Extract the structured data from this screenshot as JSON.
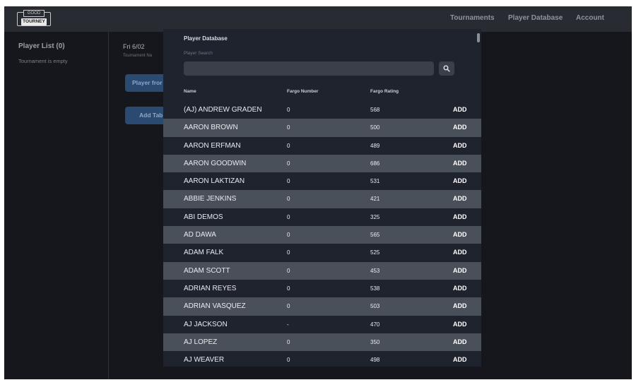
{
  "logo": {
    "top": "GOOD",
    "bottom": "TOURNEY"
  },
  "nav": {
    "tournaments": "Tournaments",
    "player_database": "Player Database",
    "account": "Account"
  },
  "sidebar": {
    "title": "Player List (0)",
    "empty_text": "Tournament is empty"
  },
  "main": {
    "date": "Fri 6/02",
    "tournament_name": "Tournament Na",
    "player_button": "Player fror",
    "add_table_button": "Add Tab"
  },
  "modal": {
    "title": "Player Database",
    "search_label": "Player Search",
    "search_value": "",
    "search_icon": "search-icon",
    "columns": {
      "name": "Name",
      "fargo_number": "Fargo Number",
      "fargo_rating": "Fargo Rating"
    },
    "rows": [
      {
        "name": "(AJ) ANDREW GRADEN",
        "fargo_number": "0",
        "fargo_rating": "568",
        "action": "ADD"
      },
      {
        "name": "AARON BROWN",
        "fargo_number": "0",
        "fargo_rating": "500",
        "action": "ADD"
      },
      {
        "name": "AARON ERFMAN",
        "fargo_number": "0",
        "fargo_rating": "489",
        "action": "ADD"
      },
      {
        "name": "AARON GOODWIN",
        "fargo_number": "0",
        "fargo_rating": "686",
        "action": "ADD"
      },
      {
        "name": "AARON LAKTIZAN",
        "fargo_number": "0",
        "fargo_rating": "531",
        "action": "ADD"
      },
      {
        "name": "ABBIE JENKINS",
        "fargo_number": "0",
        "fargo_rating": "421",
        "action": "ADD"
      },
      {
        "name": "ABI DEMOS",
        "fargo_number": "0",
        "fargo_rating": "325",
        "action": "ADD"
      },
      {
        "name": "AD DAWA",
        "fargo_number": "0",
        "fargo_rating": "565",
        "action": "ADD"
      },
      {
        "name": "ADAM FALK",
        "fargo_number": "0",
        "fargo_rating": "525",
        "action": "ADD"
      },
      {
        "name": "ADAM SCOTT",
        "fargo_number": "0",
        "fargo_rating": "453",
        "action": "ADD"
      },
      {
        "name": "ADRIAN REYES",
        "fargo_number": "0",
        "fargo_rating": "538",
        "action": "ADD"
      },
      {
        "name": "ADRIAN VASQUEZ",
        "fargo_number": "0",
        "fargo_rating": "503",
        "action": "ADD"
      },
      {
        "name": "AJ JACKSON",
        "fargo_number": "-",
        "fargo_rating": "470",
        "action": "ADD"
      },
      {
        "name": "AJ LOPEZ",
        "fargo_number": "0",
        "fargo_rating": "350",
        "action": "ADD"
      },
      {
        "name": "AJ WEAVER",
        "fargo_number": "0",
        "fargo_rating": "498",
        "action": "ADD"
      }
    ]
  }
}
